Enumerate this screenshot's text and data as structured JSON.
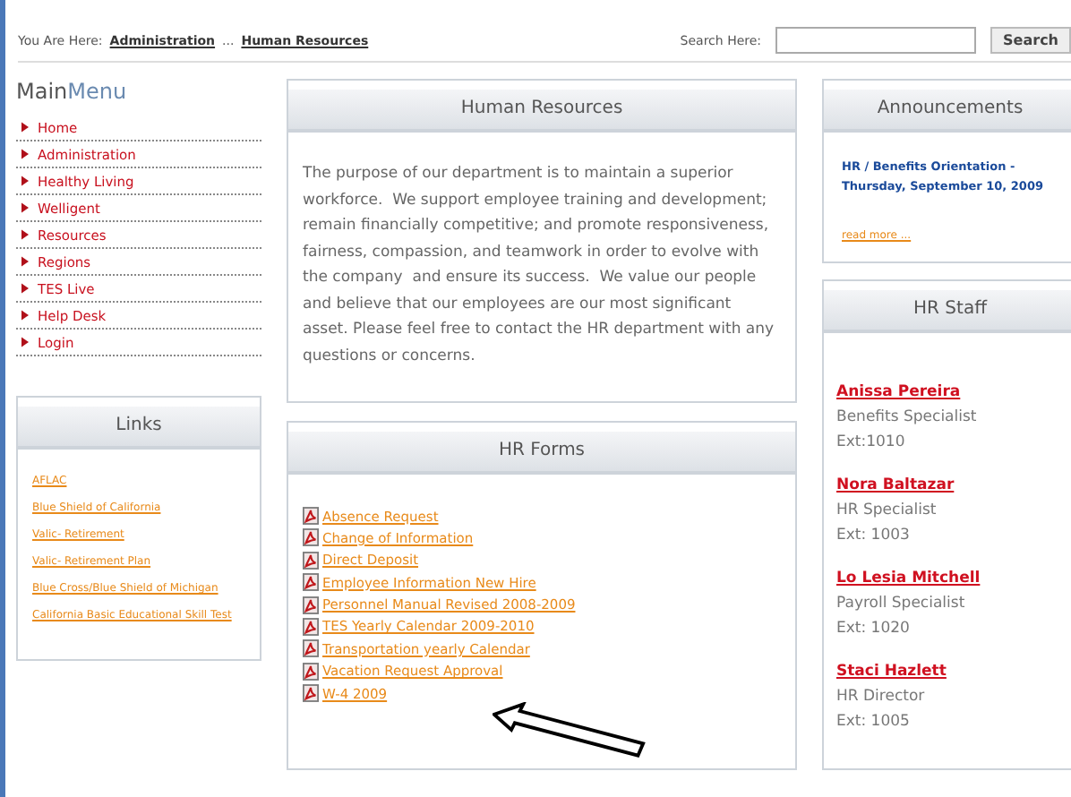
{
  "breadcrumb": {
    "label": "You Are Here:",
    "items": [
      "Administration",
      "Human Resources"
    ],
    "separator": "..."
  },
  "search": {
    "label": "Search Here:",
    "button": "Search"
  },
  "main_menu": {
    "title_main": "Main",
    "title_accent": "Menu",
    "items": [
      "Home",
      "Administration",
      "Healthy Living",
      "Welligent",
      "Resources",
      "Regions",
      "TES Live",
      "Help Desk",
      "Login"
    ]
  },
  "links": {
    "title": "Links",
    "items": [
      "AFLAC",
      "Blue Shield of California",
      "Valic- Retirement",
      "Valic- Retirement Plan",
      "Blue Cross/Blue Shield of Michigan",
      "California Basic Educational Skill Test"
    ]
  },
  "human_resources": {
    "title": "Human Resources",
    "text": "The purpose of our department is to maintain a superior workforce.  We support employee training and development; remain financially competitive; and promote responsiveness, fairness, compassion, and teamwork in order to evolve with the company  and ensure its success.  We value our people and believe that our employees are our most significant asset. Please feel free to contact the HR department with any questions or concerns."
  },
  "hr_forms": {
    "title": "HR Forms",
    "items": [
      "Absence Request",
      "Change of Information",
      "Direct Deposit",
      "Employee Information New Hire",
      "Personnel Manual Revised 2008-2009",
      "TES Yearly Calendar 2009-2010",
      "Transportation yearly Calendar",
      "Vacation Request Approval",
      "W-4 2009"
    ]
  },
  "announcements": {
    "title": "Announcements",
    "headline": "HR / Benefits Orientation - Thursday, September 10, 2009",
    "link": "read more ..."
  },
  "hr_staff": {
    "title": "HR Staff",
    "people": [
      {
        "name": "Anissa Pereira",
        "role": "Benefits Specialist",
        "ext": "Ext:1010"
      },
      {
        "name": "Nora Baltazar",
        "role": "HR Specialist",
        "ext": "Ext: 1003"
      },
      {
        "name": "Lo Lesia Mitchell",
        "role": "Payroll Specialist",
        "ext": "Ext: 1020"
      },
      {
        "name": "Staci Hazlett",
        "role": "HR Director",
        "ext": "Ext: 1005"
      }
    ]
  }
}
